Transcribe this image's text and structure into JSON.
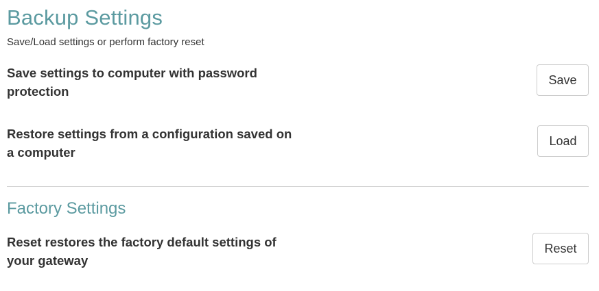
{
  "backup": {
    "title": "Backup Settings",
    "subtitle": "Save/Load settings or perform factory reset",
    "save_label": "Save settings to computer with password protection",
    "save_button": "Save",
    "restore_label": "Restore settings from a configuration saved on a computer",
    "load_button": "Load"
  },
  "factory": {
    "title": "Factory Settings",
    "reset_label": "Reset restores the factory default settings of your gateway",
    "reset_button": "Reset"
  },
  "colors": {
    "heading": "#5b9aa0",
    "text": "#333333",
    "button_border": "#cccccc",
    "divider": "#cfcfcf"
  }
}
